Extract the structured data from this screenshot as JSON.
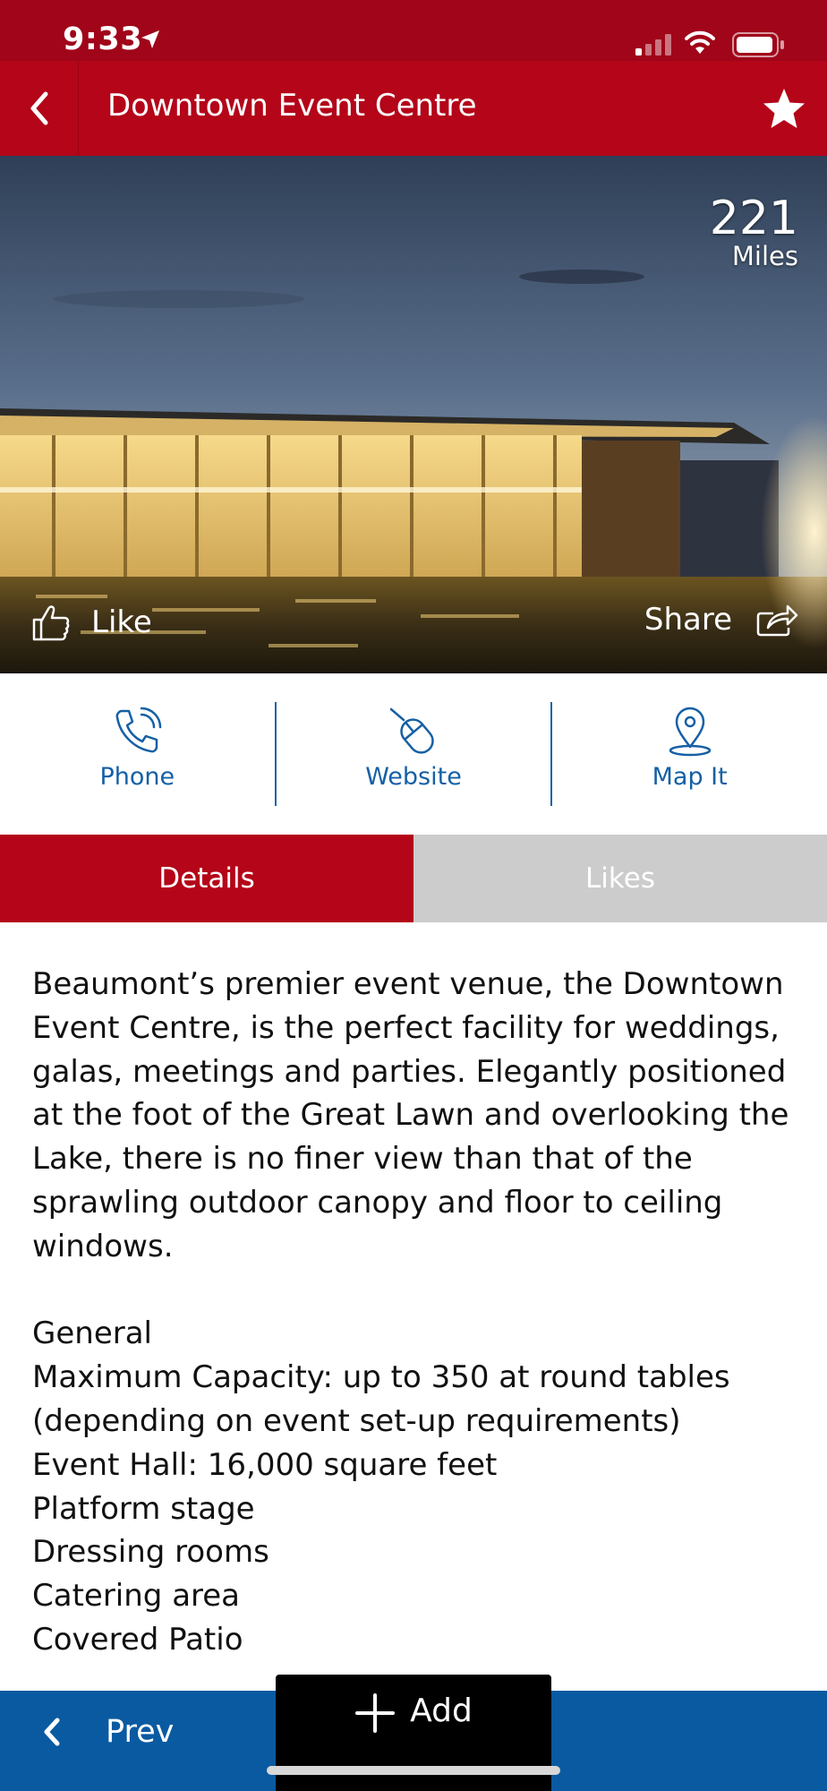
{
  "status_bar": {
    "time": "9:33"
  },
  "header": {
    "title": "Downtown Event Centre",
    "back_icon": "chevron-left-icon",
    "favorite_icon": "star-icon"
  },
  "hero": {
    "distance_value": "221",
    "distance_unit": "Miles",
    "like_label": "Like",
    "share_label": "Share"
  },
  "actions": [
    {
      "label": "Phone",
      "icon": "phone-icon"
    },
    {
      "label": "Website",
      "icon": "mouse-icon"
    },
    {
      "label": "Map It",
      "icon": "map-pin-icon"
    }
  ],
  "tabs": [
    {
      "label": "Details",
      "active": true
    },
    {
      "label": "Likes",
      "active": false
    }
  ],
  "details": {
    "description": "Beaumont’s premier event venue, the Downtown Event Centre, is the perfect facility for weddings, galas, meetings and parties.  Elegantly positioned at the foot of the Great Lawn and overlooking the Lake, there is no finer view than that of the sprawling outdoor canopy and floor to ceiling windows.",
    "lines": [
      "General",
      "Maximum Capacity: up to 350 at round tables (depending on event set-up requirements)",
      "Event Hall: 16,000 square feet",
      "Platform stage",
      "Dressing rooms",
      "Catering area",
      "Covered Patio"
    ]
  },
  "bottom_bar": {
    "prev_label": "Prev",
    "add_label": "Add"
  },
  "colors": {
    "brand_red": "#b40519",
    "status_red": "#a00519",
    "link_blue": "#1560a5",
    "bar_blue": "#0a5aa1",
    "tab_inactive": "#cccccc"
  }
}
